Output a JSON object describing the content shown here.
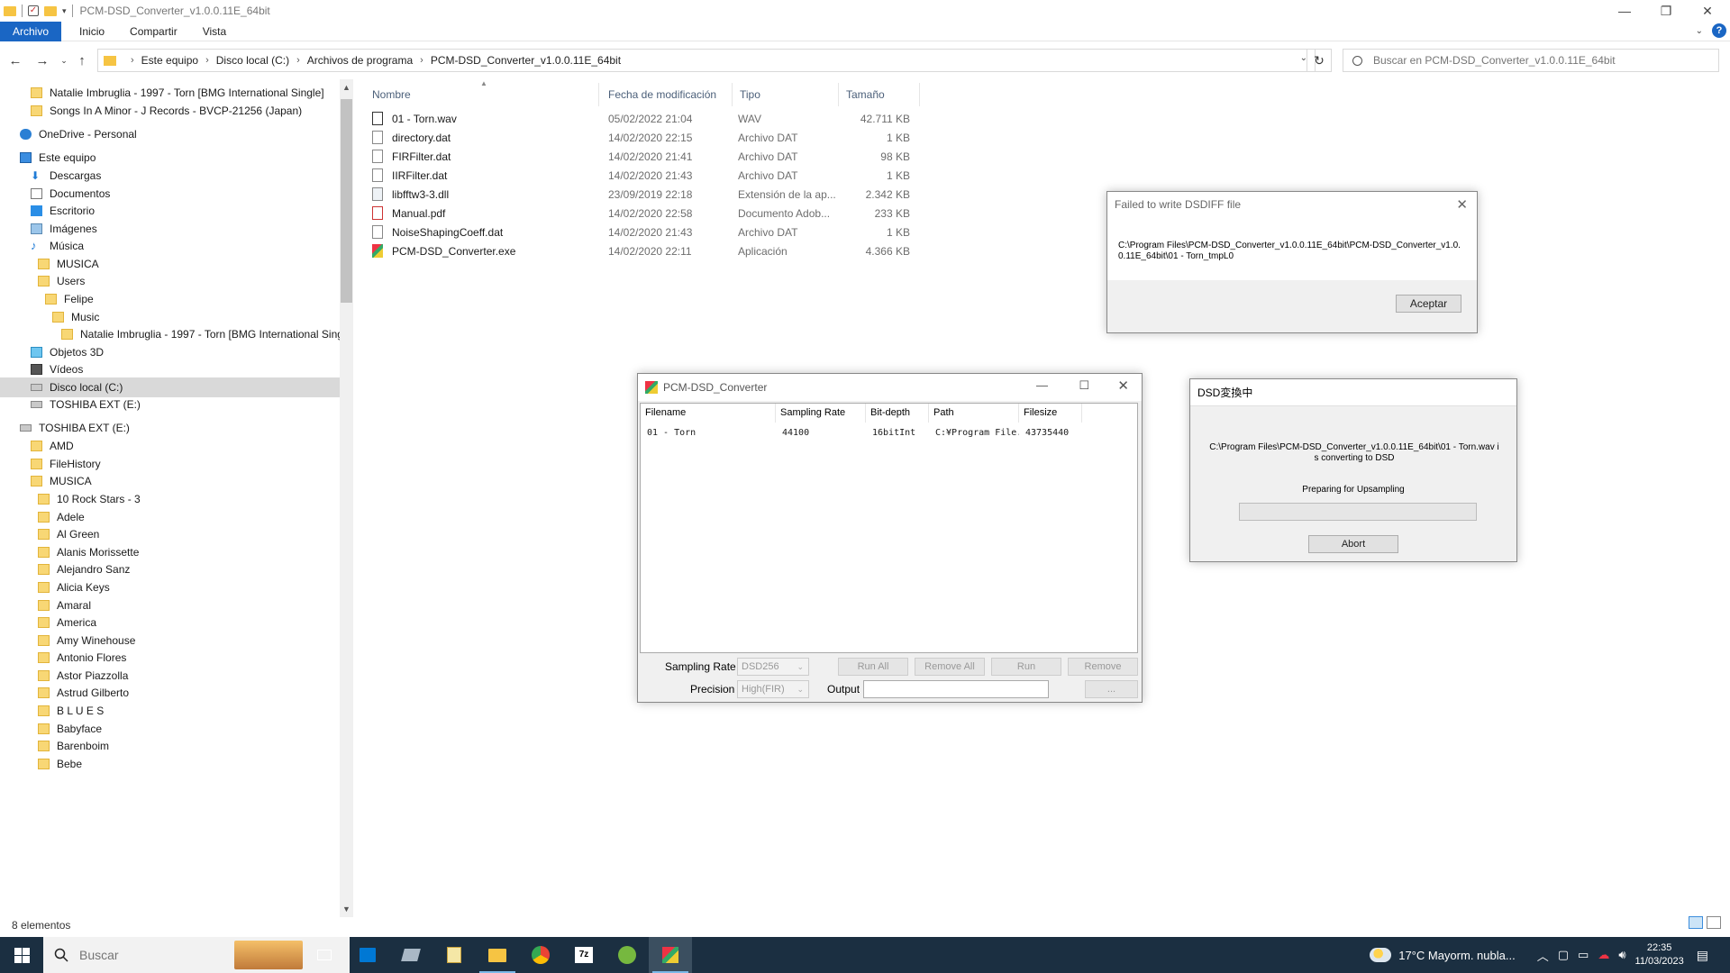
{
  "window": {
    "title": "PCM-DSD_Converter_v1.0.0.11E_64bit"
  },
  "ribbon": {
    "tabs": [
      "Archivo",
      "Inicio",
      "Compartir",
      "Vista"
    ]
  },
  "address": {
    "crumbs": [
      "Este equipo",
      "Disco local (C:)",
      "Archivos de programa",
      "PCM-DSD_Converter_v1.0.0.11E_64bit"
    ],
    "search_placeholder": "Buscar en PCM-DSD_Converter_v1.0.0.11E_64bit"
  },
  "nav": {
    "items": [
      {
        "label": "Natalie Imbruglia - 1997 - Torn [BMG International Single]",
        "icon": "folder-icon",
        "indent": 1
      },
      {
        "label": "Songs In A Minor - J Records - BVCP-21256 (Japan)",
        "icon": "folder-icon",
        "indent": 1
      },
      {
        "label": "OneDrive - Personal",
        "icon": "cloud-icon",
        "indent": 0
      },
      {
        "label": "Este equipo",
        "icon": "computer-icon",
        "indent": 0
      },
      {
        "label": "Descargas",
        "icon": "download-icon",
        "indent": 1
      },
      {
        "label": "Documentos",
        "icon": "document-icon",
        "indent": 1
      },
      {
        "label": "Escritorio",
        "icon": "desktop-icon",
        "indent": 1
      },
      {
        "label": "Imágenes",
        "icon": "image-icon",
        "indent": 1
      },
      {
        "label": "Música",
        "icon": "music-icon",
        "indent": 1
      },
      {
        "label": "MUSICA",
        "icon": "folder-icon",
        "indent": 2
      },
      {
        "label": "Users",
        "icon": "folder-icon",
        "indent": 2
      },
      {
        "label": "Felipe",
        "icon": "folder-icon",
        "indent": 3
      },
      {
        "label": "Music",
        "icon": "folder-icon",
        "indent": 4
      },
      {
        "label": "Natalie Imbruglia - 1997 - Torn [BMG International Singl",
        "icon": "folder-icon",
        "indent": 5
      },
      {
        "label": "Objetos 3D",
        "icon": "cube-icon",
        "indent": 1
      },
      {
        "label": "Vídeos",
        "icon": "video-icon",
        "indent": 1
      },
      {
        "label": "Disco local (C:)",
        "icon": "drive-icon",
        "indent": 1,
        "selected": true
      },
      {
        "label": "TOSHIBA EXT (E:)",
        "icon": "drive-icon",
        "indent": 1
      },
      {
        "label": "TOSHIBA EXT (E:)",
        "icon": "drive-icon",
        "indent": 0
      },
      {
        "label": "AMD",
        "icon": "folder-icon",
        "indent": 1
      },
      {
        "label": "FileHistory",
        "icon": "folder-icon",
        "indent": 1
      },
      {
        "label": "MUSICA",
        "icon": "folder-icon",
        "indent": 1
      },
      {
        "label": "10 Rock Stars - 3",
        "icon": "folder-icon",
        "indent": 2
      },
      {
        "label": "Adele",
        "icon": "folder-icon",
        "indent": 2
      },
      {
        "label": "Al Green",
        "icon": "folder-icon",
        "indent": 2
      },
      {
        "label": "Alanis Morissette",
        "icon": "folder-icon",
        "indent": 2
      },
      {
        "label": "Alejandro Sanz",
        "icon": "folder-icon",
        "indent": 2
      },
      {
        "label": "Alicia Keys",
        "icon": "folder-icon",
        "indent": 2
      },
      {
        "label": "Amaral",
        "icon": "folder-icon",
        "indent": 2
      },
      {
        "label": "America",
        "icon": "folder-icon",
        "indent": 2
      },
      {
        "label": "Amy Winehouse",
        "icon": "folder-icon",
        "indent": 2
      },
      {
        "label": "Antonio Flores",
        "icon": "folder-icon",
        "indent": 2
      },
      {
        "label": "Astor Piazzolla",
        "icon": "folder-icon",
        "indent": 2
      },
      {
        "label": "Astrud Gilberto",
        "icon": "folder-icon",
        "indent": 2
      },
      {
        "label": "B L U E S",
        "icon": "folder-icon",
        "indent": 2
      },
      {
        "label": "Babyface",
        "icon": "folder-icon",
        "indent": 2
      },
      {
        "label": "Barenboim",
        "icon": "folder-icon",
        "indent": 2
      },
      {
        "label": "Bebe",
        "icon": "folder-icon",
        "indent": 2
      }
    ]
  },
  "files": {
    "columns": [
      "Nombre",
      "Fecha de modificación",
      "Tipo",
      "Tamaño"
    ],
    "rows": [
      {
        "name": "01 - Torn.wav",
        "date": "05/02/2022 21:04",
        "type": "WAV",
        "size": "42.711 KB",
        "icon": "audio-file-icon"
      },
      {
        "name": "directory.dat",
        "date": "14/02/2020 22:15",
        "type": "Archivo DAT",
        "size": "1 KB",
        "icon": "file-icon"
      },
      {
        "name": "FIRFilter.dat",
        "date": "14/02/2020 21:41",
        "type": "Archivo DAT",
        "size": "98 KB",
        "icon": "file-icon"
      },
      {
        "name": "IIRFilter.dat",
        "date": "14/02/2020 21:43",
        "type": "Archivo DAT",
        "size": "1 KB",
        "icon": "file-icon"
      },
      {
        "name": "libfftw3-3.dll",
        "date": "23/09/2019 22:18",
        "type": "Extensión de la ap...",
        "size": "2.342 KB",
        "icon": "dll-file-icon"
      },
      {
        "name": "Manual.pdf",
        "date": "14/02/2020 22:58",
        "type": "Documento Adob...",
        "size": "233 KB",
        "icon": "pdf-file-icon"
      },
      {
        "name": "NoiseShapingCoeff.dat",
        "date": "14/02/2020 21:43",
        "type": "Archivo DAT",
        "size": "1 KB",
        "icon": "file-icon"
      },
      {
        "name": "PCM-DSD_Converter.exe",
        "date": "14/02/2020 22:11",
        "type": "Aplicación",
        "size": "4.366 KB",
        "icon": "exe-file-icon"
      }
    ]
  },
  "status": {
    "count": "8 elementos"
  },
  "error_dialog": {
    "title": "Failed to write DSDIFF file",
    "message": "C:\\Program Files\\PCM-DSD_Converter_v1.0.0.11E_64bit\\PCM-DSD_Converter_v1.0.0.11E_64bit\\01 - Torn_tmpL0",
    "ok_label": "Aceptar"
  },
  "pcm_window": {
    "title": "PCM-DSD_Converter",
    "columns": [
      "Filename",
      "Sampling Rate",
      "Bit-depth",
      "Path",
      "Filesize"
    ],
    "rows": [
      {
        "filename": "01 - Torn",
        "rate": "44100",
        "depth": "16bitInt",
        "path": "C:¥Program File...",
        "size": "43735440"
      }
    ],
    "sampling_rate_label": "Sampling Rate",
    "sampling_rate_value": "DSD256",
    "precision_label": "Precision",
    "precision_value": "High(FIR)",
    "output_label": "Output",
    "buttons": {
      "run_all": "Run All",
      "remove_all": "Remove All",
      "run": "Run",
      "remove": "Remove",
      "browse": "..."
    }
  },
  "progress_dialog": {
    "title": "DSD変換中",
    "message": "C:\\Program Files\\PCM-DSD_Converter_v1.0.0.11E_64bit\\01 - Torn.wav is converting to DSD",
    "status": "Preparing for Upsampling",
    "progress": 0,
    "abort_label": "Abort"
  },
  "taskbar": {
    "search_placeholder": "Buscar",
    "weather": "17°C  Mayorm. nubla...",
    "time": "22:35",
    "date": "11/03/2023"
  },
  "colors": {
    "accent": "#1a66c4",
    "taskbar": "#1b2f41",
    "folder": "#f8d775"
  }
}
